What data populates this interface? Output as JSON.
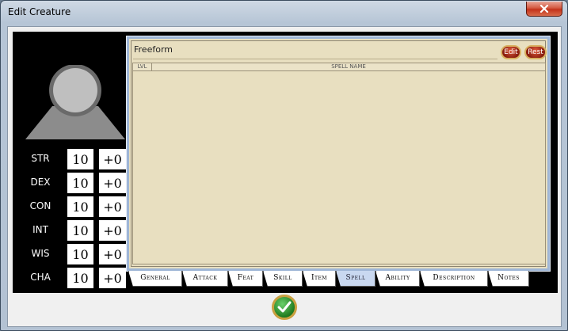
{
  "window": {
    "title": "Edit Creature"
  },
  "sheet": {
    "freeform_label": "Freeform",
    "edit_label": "Edit",
    "rest_label": "Rest",
    "columns": {
      "lvl": "LVL",
      "spell_name": "SPELL NAME"
    }
  },
  "stats": [
    {
      "label": "STR",
      "score": "10",
      "mod": "+0"
    },
    {
      "label": "DEX",
      "score": "10",
      "mod": "+0"
    },
    {
      "label": "CON",
      "score": "10",
      "mod": "+0"
    },
    {
      "label": "INT",
      "score": "10",
      "mod": "+0"
    },
    {
      "label": "WIS",
      "score": "10",
      "mod": "+0"
    },
    {
      "label": "CHA",
      "score": "10",
      "mod": "+0"
    }
  ],
  "tabs": [
    {
      "label": "General"
    },
    {
      "label": "Attack"
    },
    {
      "label": "Feat"
    },
    {
      "label": "Skill"
    },
    {
      "label": "Item"
    },
    {
      "label": "Spell"
    },
    {
      "label": "Ability"
    },
    {
      "label": "Description"
    },
    {
      "label": "Notes"
    }
  ],
  "active_tab": "Spell",
  "colors": {
    "sheet_bg": "#e8dfc0",
    "panel_bg": "#000000",
    "active_tab": "#c9d8f0",
    "ok_green": "#2a8a2a"
  },
  "icons": {
    "close": "close-icon",
    "portrait": "portrait-silhouette-icon",
    "confirm": "checkmark-icon"
  }
}
